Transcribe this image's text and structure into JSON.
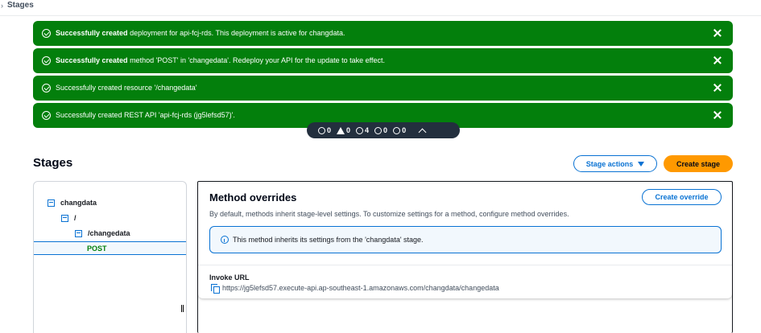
{
  "breadcrumb": {
    "separator": "›",
    "current": "Stages"
  },
  "flashbar": [
    {
      "bold": "Successfully created",
      "text": " deployment for api-fcj-rds. This deployment is active for changdata."
    },
    {
      "bold": "Successfully created",
      "text": " method 'POST' in 'changedata'. Redeploy your API for the update to take effect."
    },
    {
      "bold": "",
      "text": "Successfully created resource '/changedata'"
    },
    {
      "bold": "",
      "text": "Successfully created REST API 'api-fcj-rds (jg5lefsd57)'."
    }
  ],
  "counter": {
    "error": "0",
    "warning": "0",
    "success": "4",
    "info": "0",
    "in_progress": "0"
  },
  "page": {
    "title": "Stages",
    "stage_actions_label": "Stage actions",
    "create_stage_label": "Create stage"
  },
  "tree": {
    "stage": "changdata",
    "root": "/",
    "resource": "/changedata",
    "method": "POST"
  },
  "method_overrides": {
    "title": "Method overrides",
    "description": "By default, methods inherit stage-level settings. To customize settings for a method, configure method overrides.",
    "create_override_label": "Create override",
    "info_text": "This method inherits its settings from the 'changdata' stage.",
    "invoke_url_label": "Invoke URL",
    "invoke_url": "https://jg5lefsd57.execute-api.ap-southeast-1.amazonaws.com/changdata/changedata"
  },
  "colors": {
    "success": "#037f0c",
    "accent": "#0972d3",
    "primary_button": "#ff9900",
    "counter_bg": "#232f3e"
  }
}
